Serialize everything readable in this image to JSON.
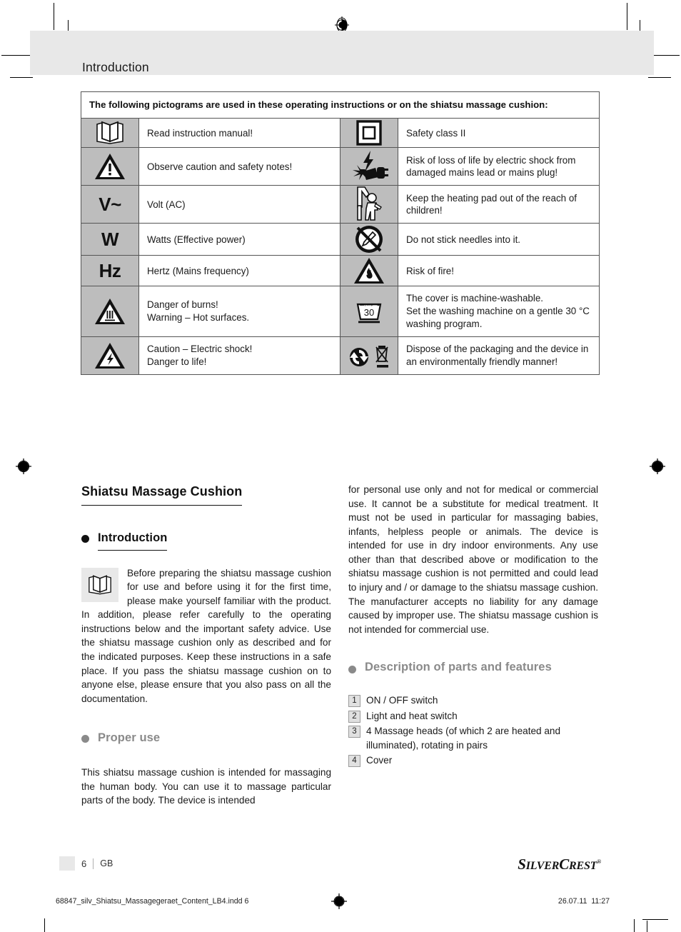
{
  "header": {
    "running_head": "Introduction"
  },
  "pictogram_table": {
    "caption": "The following pictograms are used in these operating instructions or on the shiatsu massage cushion:",
    "rows": [
      {
        "left": {
          "icon": "open-book-icon",
          "icon_text": "",
          "text": "Read instruction manual!"
        },
        "right": {
          "icon": "safety-class-ii-icon",
          "icon_text": "",
          "text": "Safety class II"
        }
      },
      {
        "left": {
          "icon": "warning-triangle-icon",
          "icon_text": "",
          "text": "Observe caution and safety notes!"
        },
        "right": {
          "icon": "electric-shock-plug-icon",
          "icon_text": "",
          "text": "Risk of loss of life by electric shock from damaged mains lead or mains plug!"
        }
      },
      {
        "left": {
          "icon": "volt-symbol",
          "icon_text": "V~",
          "text": "Volt (AC)"
        },
        "right": {
          "icon": "keep-away-from-children-icon",
          "icon_text": "",
          "text": "Keep the heating pad out of the reach of children!"
        }
      },
      {
        "left": {
          "icon": "watt-symbol",
          "icon_text": "W",
          "text": "Watts (Effective power)"
        },
        "right": {
          "icon": "no-needles-icon",
          "icon_text": "",
          "text": "Do not stick needles into it."
        }
      },
      {
        "left": {
          "icon": "hertz-symbol",
          "icon_text": "Hz",
          "text": "Hertz (Mains frequency)"
        },
        "right": {
          "icon": "fire-risk-icon",
          "icon_text": "",
          "text": "Risk of fire!"
        }
      },
      {
        "left": {
          "icon": "hot-surface-triangle-icon",
          "icon_text": "",
          "text": "Danger of burns!\nWarning – Hot surfaces."
        },
        "right": {
          "icon": "machine-wash-30-icon",
          "icon_text": "",
          "text": "The cover is machine-washable.\nSet the washing machine on a gentle 30 °C washing program."
        }
      },
      {
        "left": {
          "icon": "electric-shock-triangle-icon",
          "icon_text": "",
          "text": "Caution – Electric shock!\nDanger to life!"
        },
        "right": {
          "icon": "recycle-disposal-icon",
          "icon_text": "",
          "text": "Dispose of the packaging and the device in an environmentally friendly manner!"
        }
      }
    ]
  },
  "content": {
    "product_title": "Shiatsu Massage Cushion",
    "introduction": {
      "heading": "Introduction",
      "icon": "open-book-icon",
      "paragraph": "Before preparing the shiatsu massage cushion for use and before using it for the first time, please make yourself familiar with the product. In addition, please refer carefully to the operating instructions below and the important safety advice. Use the shiatsu massage cushion only as described and for the indicated purposes. Keep these instructions in a safe place. If you pass the shiatsu massage cushion on to anyone else, please ensure that you also pass on all the documentation."
    },
    "proper_use": {
      "heading": "Proper use",
      "paragraph_left": "This shiatsu massage cushion is intended for massaging the human body. You can use it to massage particular parts of the body. The device is intended",
      "paragraph_right": "for personal use only and not for medical or commercial use. It cannot be a substitute for medical treatment. It must not be used in particular for massaging babies, infants, helpless people or animals. The device is intended for use in dry indoor environments. Any use other than that described above or modification to the shiatsu massage cushion is not permitted and could lead to injury and / or damage to the shiatsu massage cushion. The manufacturer accepts no liability for any damage caused by improper use. The shiatsu massage cushion is not intended for commercial use."
    },
    "description_of_parts": {
      "heading": "Description of parts and features",
      "items": [
        {
          "number": "1",
          "label": "ON / OFF switch"
        },
        {
          "number": "2",
          "label": "Light and heat switch"
        },
        {
          "number": "3",
          "label": "4 Massage heads (of which 2 are heated and illuminated), rotating in pairs"
        },
        {
          "number": "4",
          "label": "Cover"
        }
      ]
    }
  },
  "footer": {
    "page_number": "6",
    "language_code": "GB",
    "brand_part1": "S",
    "brand_part2": "ILVER",
    "brand_part3": "C",
    "brand_part4": "REST",
    "brand_registered": "®",
    "print_file": "68847_silv_Shiatsu_Massagegeraet_Content_LB4.indd   6",
    "print_date": "26.07.11",
    "print_time": "11:27"
  },
  "colors": {
    "header_band": "#e8e8e8",
    "icon_cell": "#bdbdbd",
    "table_border": "#555555",
    "gray_heading": "#8a8a8a",
    "number_box": "#e0e0e0"
  }
}
